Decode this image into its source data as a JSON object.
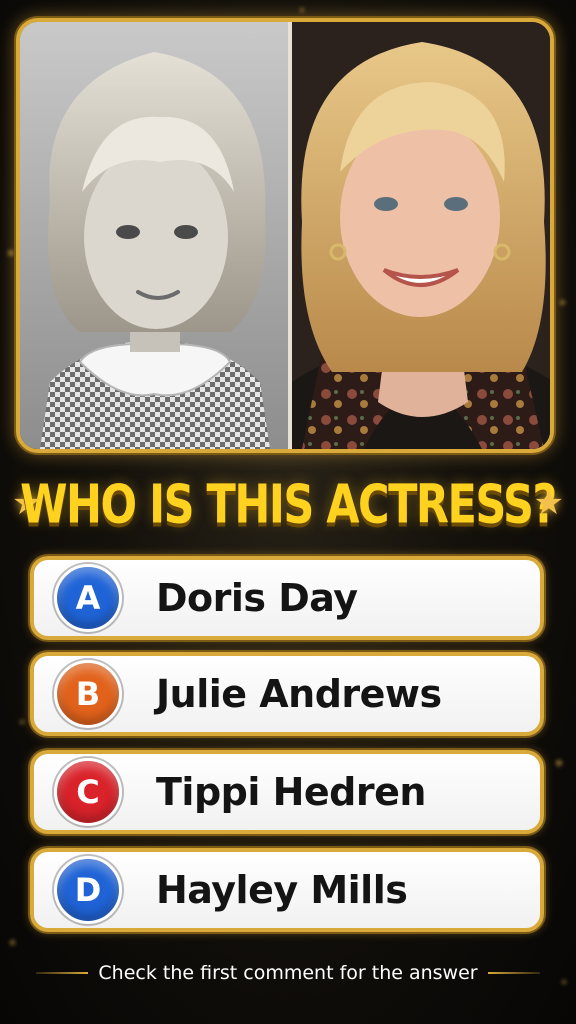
{
  "photos": {
    "left_icon": "vintage-portrait-bw",
    "right_icon": "modern-portrait-color"
  },
  "title": {
    "text": "WHO IS THIS ACTRESS?",
    "decoration_icon": "star-icon",
    "color": "#ffd21f"
  },
  "options": [
    {
      "letter": "A",
      "label": "Doris Day",
      "color": "#1f63d6"
    },
    {
      "letter": "B",
      "label": "Julie Andrews",
      "color": "#e2621b"
    },
    {
      "letter": "C",
      "label": "Tippi Hedren",
      "color": "#d9222a"
    },
    {
      "letter": "D",
      "label": "Hayley Mills",
      "color": "#1f63d6"
    }
  ],
  "footer": {
    "text": "Check the first comment for the answer"
  },
  "theme": {
    "frame_gold": "#d9a93a",
    "background": "#14110c"
  }
}
